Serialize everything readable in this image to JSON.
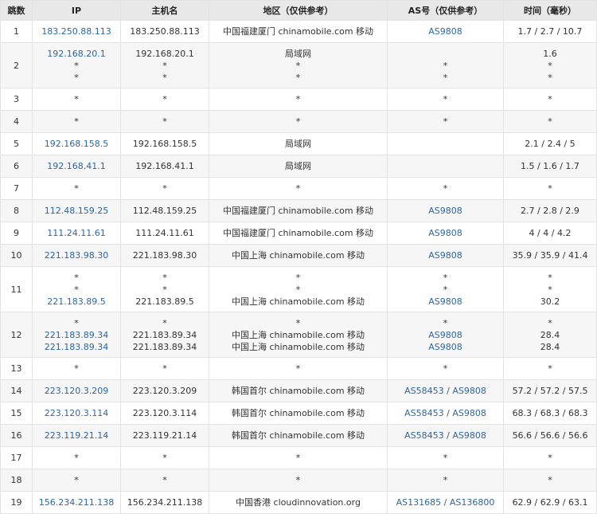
{
  "headers": [
    "跳数",
    "IP",
    "主机名",
    "地区（仅供参考）",
    "AS号（仅供参考）",
    "时间（毫秒）"
  ],
  "rows": [
    {
      "hop": "1",
      "ip": [
        "183.250.88.113"
      ],
      "host": [
        "183.250.88.113"
      ],
      "region": [
        "中国福建厦门 chinamobile.com 移动"
      ],
      "asn": [
        [
          "AS9808"
        ]
      ],
      "time": [
        "1.7 / 2.7 / 10.7"
      ]
    },
    {
      "hop": "2",
      "ip": [
        "192.168.20.1",
        "*",
        "*"
      ],
      "host": [
        "192.168.20.1",
        "*",
        "*"
      ],
      "region": [
        "局域网",
        "*",
        "*"
      ],
      "asn": [
        [],
        [
          "*"
        ],
        [
          "*"
        ]
      ],
      "time": [
        "1.6",
        "*",
        "*"
      ]
    },
    {
      "hop": "3",
      "ip": [
        "*"
      ],
      "host": [
        "*"
      ],
      "region": [
        "*"
      ],
      "asn": [
        [
          "*"
        ]
      ],
      "time": [
        "*"
      ]
    },
    {
      "hop": "4",
      "ip": [
        "*"
      ],
      "host": [
        "*"
      ],
      "region": [
        "*"
      ],
      "asn": [
        [
          "*"
        ]
      ],
      "time": [
        "*"
      ]
    },
    {
      "hop": "5",
      "ip": [
        "192.168.158.5"
      ],
      "host": [
        "192.168.158.5"
      ],
      "region": [
        "局域网"
      ],
      "asn": [
        []
      ],
      "time": [
        "2.1 / 2.4 / 5"
      ]
    },
    {
      "hop": "6",
      "ip": [
        "192.168.41.1"
      ],
      "host": [
        "192.168.41.1"
      ],
      "region": [
        "局域网"
      ],
      "asn": [
        []
      ],
      "time": [
        "1.5 / 1.6 / 1.7"
      ]
    },
    {
      "hop": "7",
      "ip": [
        "*"
      ],
      "host": [
        "*"
      ],
      "region": [
        "*"
      ],
      "asn": [
        [
          "*"
        ]
      ],
      "time": [
        "*"
      ]
    },
    {
      "hop": "8",
      "ip": [
        "112.48.159.25"
      ],
      "host": [
        "112.48.159.25"
      ],
      "region": [
        "中国福建厦门 chinamobile.com 移动"
      ],
      "asn": [
        [
          "AS9808"
        ]
      ],
      "time": [
        "2.7 / 2.8 / 2.9"
      ]
    },
    {
      "hop": "9",
      "ip": [
        "111.24.11.61"
      ],
      "host": [
        "111.24.11.61"
      ],
      "region": [
        "中国福建厦门 chinamobile.com 移动"
      ],
      "asn": [
        [
          "AS9808"
        ]
      ],
      "time": [
        "4 / 4 / 4.2"
      ]
    },
    {
      "hop": "10",
      "ip": [
        "221.183.98.30"
      ],
      "host": [
        "221.183.98.30"
      ],
      "region": [
        "中国上海 chinamobile.com 移动"
      ],
      "asn": [
        [
          "AS9808"
        ]
      ],
      "time": [
        "35.9 / 35.9 / 41.4"
      ]
    },
    {
      "hop": "11",
      "ip": [
        "*",
        "*",
        "221.183.89.5"
      ],
      "host": [
        "*",
        "*",
        "221.183.89.5"
      ],
      "region": [
        "*",
        "*",
        "中国上海 chinamobile.com 移动"
      ],
      "asn": [
        [
          "*"
        ],
        [
          "*"
        ],
        [
          "AS9808"
        ]
      ],
      "time": [
        "*",
        "*",
        "30.2"
      ]
    },
    {
      "hop": "12",
      "ip": [
        "*",
        "221.183.89.34",
        "221.183.89.34"
      ],
      "host": [
        "*",
        "221.183.89.34",
        "221.183.89.34"
      ],
      "region": [
        "*",
        "中国上海 chinamobile.com 移动",
        "中国上海 chinamobile.com 移动"
      ],
      "asn": [
        [
          "*"
        ],
        [
          "AS9808"
        ],
        [
          "AS9808"
        ]
      ],
      "time": [
        "*",
        "28.4",
        "28.4"
      ]
    },
    {
      "hop": "13",
      "ip": [
        "*"
      ],
      "host": [
        "*"
      ],
      "region": [
        "*"
      ],
      "asn": [
        [
          "*"
        ]
      ],
      "time": [
        "*"
      ]
    },
    {
      "hop": "14",
      "ip": [
        "223.120.3.209"
      ],
      "host": [
        "223.120.3.209"
      ],
      "region": [
        "韩国首尔 chinamobile.com 移动"
      ],
      "asn": [
        [
          "AS58453",
          "AS9808"
        ]
      ],
      "time": [
        "57.2 / 57.2 / 57.5"
      ]
    },
    {
      "hop": "15",
      "ip": [
        "223.120.3.114"
      ],
      "host": [
        "223.120.3.114"
      ],
      "region": [
        "韩国首尔 chinamobile.com 移动"
      ],
      "asn": [
        [
          "AS58453",
          "AS9808"
        ]
      ],
      "time": [
        "68.3 / 68.3 / 68.3"
      ]
    },
    {
      "hop": "16",
      "ip": [
        "223.119.21.14"
      ],
      "host": [
        "223.119.21.14"
      ],
      "region": [
        "韩国首尔 chinamobile.com 移动"
      ],
      "asn": [
        [
          "AS58453",
          "AS9808"
        ]
      ],
      "time": [
        "56.6 / 56.6 / 56.6"
      ]
    },
    {
      "hop": "17",
      "ip": [
        "*"
      ],
      "host": [
        "*"
      ],
      "region": [
        "*"
      ],
      "asn": [
        [
          "*"
        ]
      ],
      "time": [
        "*"
      ]
    },
    {
      "hop": "18",
      "ip": [
        "*"
      ],
      "host": [
        "*"
      ],
      "region": [
        "*"
      ],
      "asn": [
        [
          "*"
        ]
      ],
      "time": [
        "*"
      ]
    },
    {
      "hop": "19",
      "ip": [
        "156.234.211.138"
      ],
      "host": [
        "156.234.211.138"
      ],
      "region": [
        "中国香港 cloudinnovation.org"
      ],
      "asn": [
        [
          "AS131685",
          "AS136800"
        ]
      ],
      "time": [
        "62.9 / 62.9 / 63.1"
      ]
    }
  ],
  "colors": {
    "link": "#2b66a6",
    "header_bg": "#e8e8e8",
    "alt_row_bg": "#f6f6f6",
    "border": "#e3e3e3"
  }
}
